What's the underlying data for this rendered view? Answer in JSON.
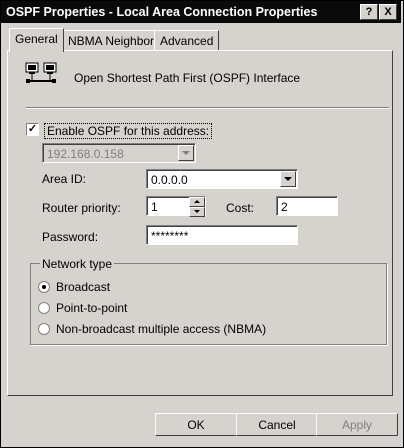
{
  "window": {
    "title": "OSPF Properties - Local Area Connection Properties",
    "help_button": "?",
    "close_button": "X"
  },
  "tabs": [
    {
      "label": "General",
      "active": true
    },
    {
      "label": "NBMA Neighbors",
      "active": false
    },
    {
      "label": "Advanced",
      "active": false
    }
  ],
  "general": {
    "header_text": "Open Shortest Path First (OSPF) Interface",
    "enable_ospf": {
      "label": "Enable OSPF for this address:",
      "checked": true,
      "mark": "✓"
    },
    "address": {
      "value": "192.168.0.158",
      "disabled": true
    },
    "area_id": {
      "label": "Area ID:",
      "value": "0.0.0.0"
    },
    "router_priority": {
      "label": "Router priority:",
      "value": "1"
    },
    "cost": {
      "label": "Cost:",
      "value": "2"
    },
    "password": {
      "label": "Password:",
      "value": "********"
    },
    "network_type": {
      "label": "Network type",
      "options": [
        {
          "label": "Broadcast",
          "selected": true
        },
        {
          "label": "Point-to-point",
          "selected": false
        },
        {
          "label": "Non-broadcast multiple access (NBMA)",
          "selected": false
        }
      ]
    }
  },
  "buttons": {
    "ok": "OK",
    "cancel": "Cancel",
    "apply": "Apply"
  }
}
